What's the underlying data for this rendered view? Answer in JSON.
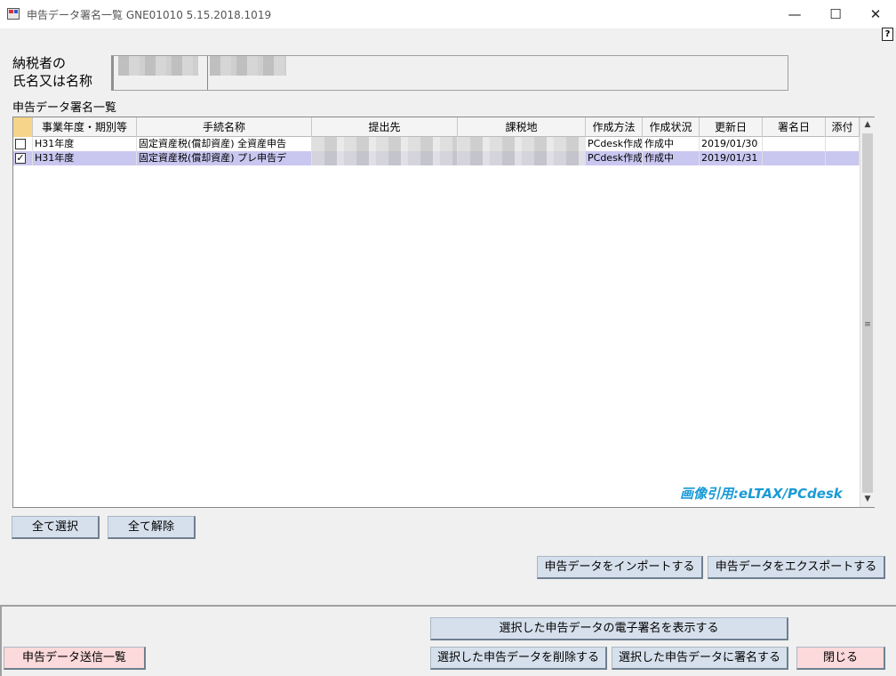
{
  "window": {
    "title": "申告データ署名一覧 GNE01010  5.15.2018.1019",
    "minimize_glyph": "—",
    "maximize_glyph": "☐",
    "close_glyph": "✕",
    "help_glyph": "?"
  },
  "taxpayer": {
    "label": "納税者の\n氏名又は名称"
  },
  "list": {
    "label": "申告データ署名一覧",
    "columns": [
      "事業年度・期別等",
      "手続名称",
      "提出先",
      "課税地",
      "作成方法",
      "作成状況",
      "更新日",
      "署名日",
      "添付"
    ],
    "rows": [
      {
        "checked": false,
        "checkmark": "",
        "period": "H31年度",
        "procedure": "固定資産税(償却資産)  全資産申告",
        "method": "PCdesk作成",
        "status": "作成中",
        "updated": "2019/01/30",
        "signed": "",
        "attach": ""
      },
      {
        "checked": true,
        "checkmark": "✓",
        "period": "H31年度",
        "procedure": "固定資産税(償却資産)  プレ申告デ",
        "method": "PCdesk作成",
        "status": "作成中",
        "updated": "2019/01/31",
        "signed": "",
        "attach": ""
      }
    ],
    "watermark": "画像引用:eLTAX/PCdesk"
  },
  "buttons": {
    "select_all": "全て選択",
    "deselect_all": "全て解除",
    "import": "申告データをインポートする",
    "export": "申告データをエクスポートする",
    "show_signature": "選択した申告データの電子署名を表示する",
    "send_list": "申告データ送信一覧",
    "delete": "選択した申告データを削除する",
    "sign": "選択した申告データに署名する",
    "close": "閉じる"
  },
  "colors": {
    "selected_row": "#c9c6f0",
    "button": "#d6e0ec",
    "pink_button": "#fcd9da",
    "watermark": "#1a9ad6"
  }
}
